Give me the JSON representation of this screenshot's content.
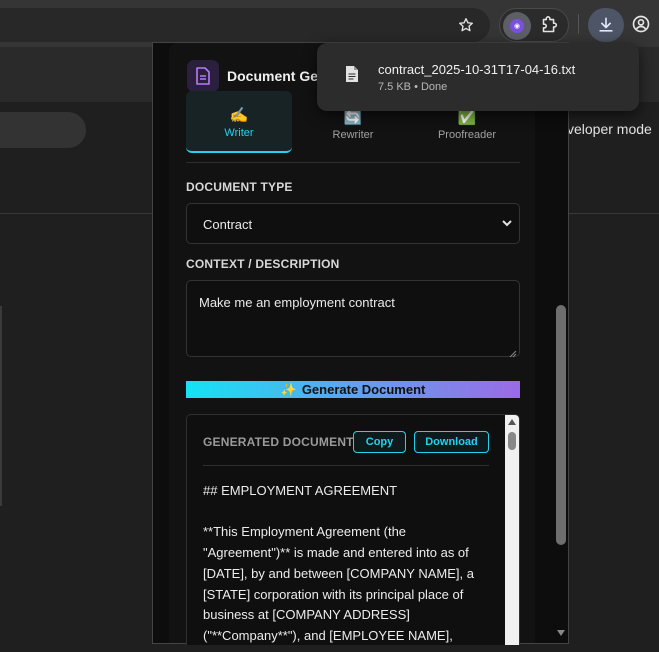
{
  "browser": {
    "download_file_name": "contract_2025-10-31T17-04-16.txt",
    "download_file_meta": "7.5 KB • Done",
    "background_page_text": "veloper mode"
  },
  "popup": {
    "app_title": "Document Gen",
    "tabs": [
      {
        "label": "Writer",
        "icon": "writing-hand-icon",
        "emoji": "✍️",
        "active": true
      },
      {
        "label": "Rewriter",
        "icon": "arrows-cycle-icon",
        "emoji": "🔄",
        "active": false
      },
      {
        "label": "Proofreader",
        "icon": "check-mark-icon",
        "emoji": "✅",
        "active": false
      }
    ],
    "document_type_label": "DOCUMENT TYPE",
    "document_type_value": "Contract",
    "context_label": "CONTEXT / DESCRIPTION",
    "context_value": "Make me an employment contract",
    "generate_button": "Generate Document",
    "generate_icon": "✨",
    "output": {
      "heading": "GENERATED DOCUMENT",
      "copy_label": "Copy",
      "download_label": "Download",
      "paragraphs": [
        "## EMPLOYMENT AGREEMENT",
        "**This Employment Agreement (the \"Agreement\")** is made and entered into as of [DATE], by and between [COMPANY NAME], a [STATE] corporation with its principal place of business at [COMPANY ADDRESS] (\"**Company**\"), and [EMPLOYEE NAME],"
      ]
    }
  },
  "colors": {
    "accent": "#22d3ee",
    "gradient_start": "#14e3f5",
    "gradient_end": "#9b6ae6",
    "extension_purple": "#7b4fe0"
  }
}
